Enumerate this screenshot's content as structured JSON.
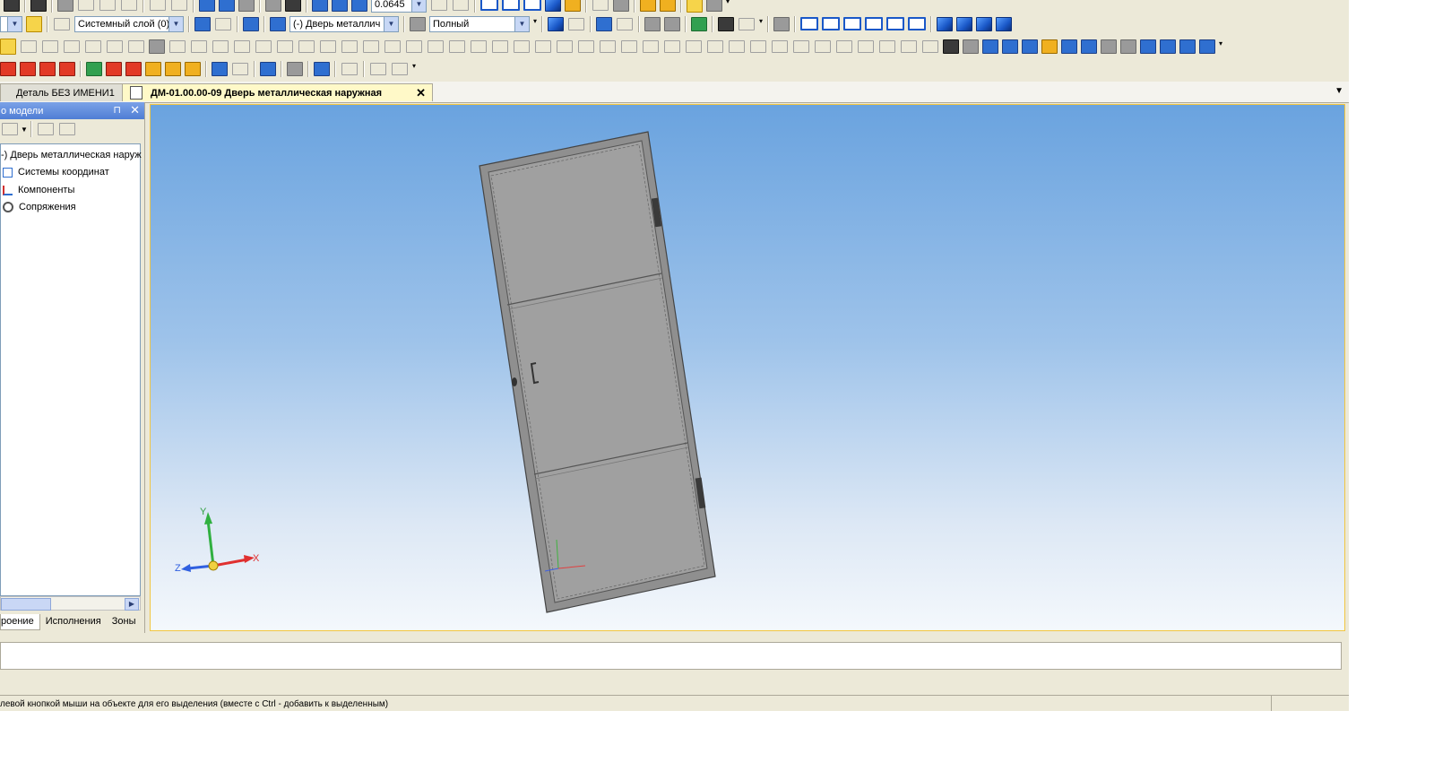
{
  "toolbar": {
    "zoom_value": "0.0645",
    "layer_combo": "Системный слой (0)",
    "object_combo": "(-) Дверь металлич",
    "display_combo": "Полный"
  },
  "tabs": [
    {
      "label": "Деталь БЕЗ ИМЕНИ1"
    },
    {
      "label": "ДМ-01.00.00-09 Дверь металлическая наружная",
      "close": "✕"
    }
  ],
  "tabs_dropdown": "▼",
  "tree_panel": {
    "title": "о модели",
    "pin": "⊓",
    "close": "✕",
    "items": [
      {
        "label": "-) Дверь металлическая наруж"
      },
      {
        "label": "Системы координат"
      },
      {
        "label": "Компоненты"
      },
      {
        "label": "Сопряжения"
      }
    ],
    "bottom_tabs": [
      {
        "label": "роение"
      },
      {
        "label": "Исполнения"
      },
      {
        "label": "Зоны"
      }
    ]
  },
  "viewport": {
    "axes": {
      "x": "X",
      "y": "Y",
      "z": "Z"
    },
    "colors": {
      "x": "#e03030",
      "y": "#30b040",
      "z": "#3060e0",
      "door": "#9c9c9c"
    }
  },
  "statusbar": {
    "hint": "левой кнопкой мыши на объекте для его выделения (вместе с Ctrl - добавить к выделенным)"
  }
}
